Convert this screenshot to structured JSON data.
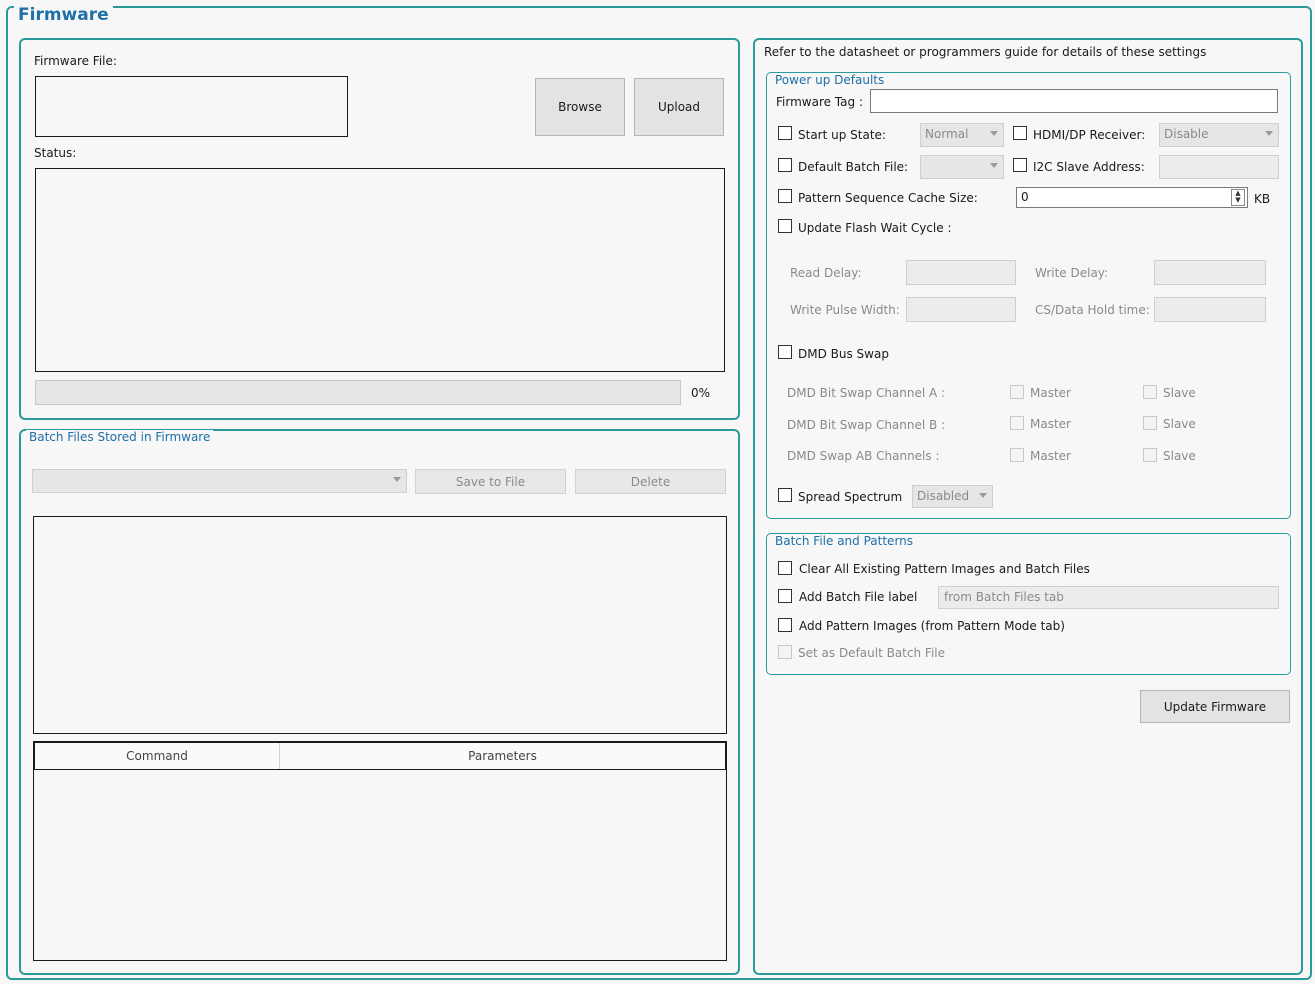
{
  "title": "Firmware",
  "upload": {
    "firmware_file_label": "Firmware File:",
    "browse_label": "Browse",
    "upload_label": "Upload",
    "status_label": "Status:",
    "progress_value": 0,
    "progress_text": "0%"
  },
  "batch_stored": {
    "legend": "Batch Files Stored in Firmware",
    "save_label": "Save to File",
    "delete_label": "Delete",
    "columns": [
      "Command",
      "Parameters"
    ]
  },
  "settings": {
    "note": "Refer to the datasheet or programmers guide for details of these settings",
    "power_up": {
      "legend": "Power up Defaults",
      "firmware_tag_label": "Firmware Tag :",
      "startup_state_label": "Start up State:",
      "startup_state_value": "Normal",
      "hdmi_label": "HDMI/DP Receiver:",
      "hdmi_value": "Disable",
      "default_batch_label": "Default Batch File:",
      "i2c_label": "I2C Slave Address:",
      "cache_label": "Pattern Sequence Cache Size:",
      "cache_value": "0",
      "cache_unit": "KB",
      "flash_wait_label": "Update Flash Wait Cycle :",
      "read_delay_label": "Read Delay:",
      "write_delay_label": "Write Delay:",
      "write_pulse_label": "Write Pulse Width:",
      "cs_hold_label": "CS/Data Hold time:",
      "dmd_bus_swap_label": "DMD Bus Swap",
      "bit_swap_a_label": "DMD Bit Swap Channel A :",
      "bit_swap_b_label": "DMD Bit Swap Channel B :",
      "swap_ab_label": "DMD Swap AB Channels :",
      "master_label": "Master",
      "slave_label": "Slave",
      "spread_label": "Spread Spectrum",
      "spread_value": "Disabled"
    },
    "batch_patterns": {
      "legend": "Batch File and Patterns",
      "clear_label": "Clear All Existing Pattern Images and Batch Files",
      "add_label_label": "Add Batch File label",
      "add_label_placeholder": "from Batch Files tab",
      "add_images_label": "Add Pattern Images (from Pattern Mode tab)",
      "set_default_label": "Set as Default Batch File"
    },
    "update_label": "Update Firmware"
  }
}
